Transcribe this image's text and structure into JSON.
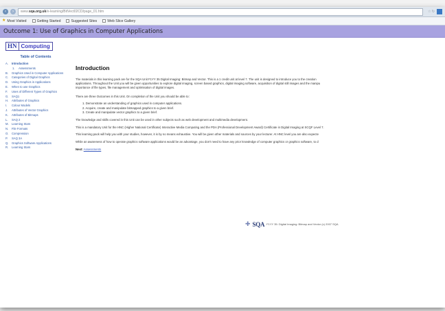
{
  "browser": {
    "url_prefix": "www.",
    "url_host": "sqa.org.uk",
    "url_path": "/e-learning/BitVect02CD/page_01.htm",
    "bookmarks": [
      {
        "label": "Most Visited",
        "icon": "star-icon"
      },
      {
        "label": "Getting Started",
        "icon": "page-icon"
      },
      {
        "label": "Suggested Sites",
        "icon": "page-icon"
      },
      {
        "label": "Web Slice Gallery",
        "icon": "page-icon"
      }
    ]
  },
  "banner": {
    "title": "Outcome 1: Use of Graphics in Computer Applications"
  },
  "logo": {
    "hn": "HN",
    "text": "Computing"
  },
  "sidebar": {
    "title": "Table of Contents",
    "items": [
      {
        "letter": "A.",
        "label": "Introduction",
        "bold": true
      },
      {
        "letter": "1.",
        "label": "Assessments",
        "sub": true
      },
      {
        "letter": "B.",
        "label": "Graphics Used in Computer Applications"
      },
      {
        "letter": "C.",
        "label": "Categories of Digital Graphics"
      },
      {
        "letter": "D.",
        "label": "Using Graphics in Applications"
      },
      {
        "letter": "E.",
        "label": "When to use Graphics"
      },
      {
        "letter": "F.",
        "label": "Uses of Different Types of Graphics"
      },
      {
        "letter": "G.",
        "label": "SAQ1"
      },
      {
        "letter": "H.",
        "label": "Attributes of Graphics"
      },
      {
        "letter": "I.",
        "label": "Colour Models"
      },
      {
        "letter": "J.",
        "label": "Attributes of Vector Graphics"
      },
      {
        "letter": "K.",
        "label": "Attributes of Bitmaps"
      },
      {
        "letter": "L.",
        "label": "SAQ 2"
      },
      {
        "letter": "M.",
        "label": "Learning Stars"
      },
      {
        "letter": "N.",
        "label": "File Formats"
      },
      {
        "letter": "O.",
        "label": "Compression"
      },
      {
        "letter": "P.",
        "label": "SAQ 3A"
      },
      {
        "letter": "Q.",
        "label": "Graphics Software Applications"
      },
      {
        "letter": "R.",
        "label": "Learning Stars"
      }
    ]
  },
  "main": {
    "heading": "Introduction",
    "intro_line1": "The materials in this learning pack are for the SQA Unit F1YY 35 Digital Imaging: Bitmap and Vector. This is a 1 credit unit at level 7. The unit is designed to introduce you to the creation",
    "intro_line2": "applications. Throughout the Unit you will be given opportunities to explore digital imaging, screen based graphics, digital imaging software, acquisition of digital still images and the manipu",
    "intro_line3": "importance of file types, file management and optimisation of digital images.",
    "outcomes_intro": "There are three Outcomes in this Unit. On completion of the Unit you should be able to:",
    "outcomes": [
      "1.  Demonstrate an understanding of graphics used in computer applications.",
      "2.  Acquire, create and manipulate bitmapped graphics to a given brief.",
      "3.  Create and manipulate vector graphics to a given brief."
    ],
    "para_knowledge": "The knowledge and skills covered in this Unit can be used in other subjects such as web development and multimedia development.",
    "para_mandatory": "This is a mandatory Unit for the HNC (Higher National Certificate) Interactive Media Computing and the PDA (Professional Development Award) Certificate in Digital Imaging at SCQF Level 7.",
    "para_help": "This learning pack will help you with your studies, however, it is by no means exhaustive. You will be given other materials and sources by your lecturer. At HNC level you are also expecte",
    "para_awareness": "While an awareness of how to operate graphics software applications would be an advantage, you don't need to have any prior knowledge of computer graphics or graphics software, to d",
    "next_label": "Next:",
    "next_link": "Assessments"
  },
  "footer": {
    "logo": "SQA",
    "text": "F1YY 35: Digital Imaging: Bitmap and Vector (c) 2007 SQA"
  }
}
